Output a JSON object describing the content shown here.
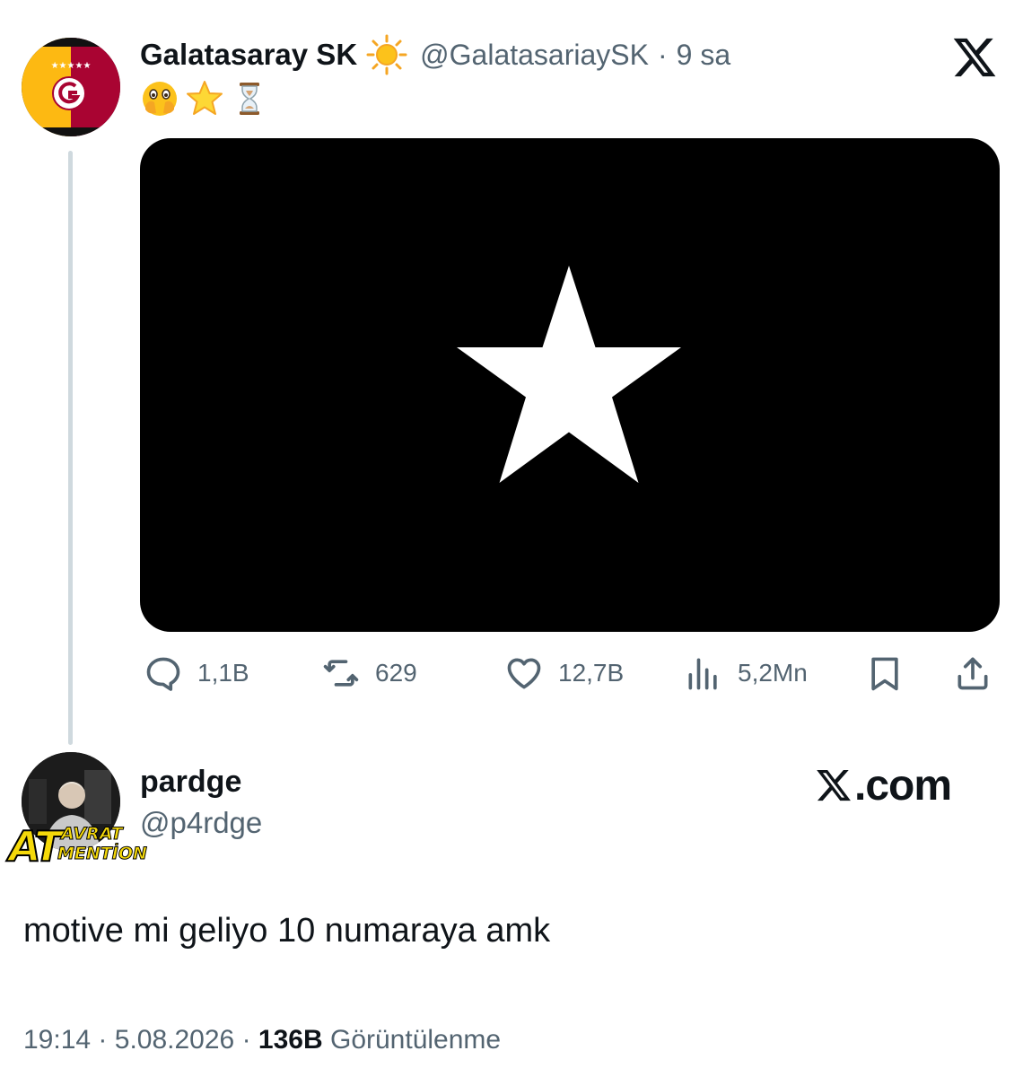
{
  "parent_tweet": {
    "display_name": "Galatasaray SK",
    "handle": "@GalatasariaySK",
    "separator": "·",
    "time_ago": "9 sa",
    "emojis": [
      "face-with-hand-over-mouth-icon",
      "star-icon",
      "hourglass-icon"
    ],
    "media": {
      "background": "#000000",
      "icon": "white-star-icon"
    },
    "actions": {
      "replies": "1,1B",
      "retweets": "629",
      "likes": "12,7B",
      "views": "5,2Mn"
    },
    "brand_colors": {
      "gs_red": "#a90432",
      "gs_yellow": "#fdb912"
    }
  },
  "reply_tweet": {
    "display_name": "pardge",
    "handle": "@p4rdge",
    "badge": {
      "letters": "AT",
      "word1": "AVRAT",
      "word2": "MENTİON"
    },
    "brand_logo_text": ".com",
    "text": "motive mi geliyo 10 numaraya amk",
    "time": "19:14",
    "date": "5.08.2026",
    "separator": "·",
    "views_count": "136B",
    "views_label": "Görüntülenme"
  },
  "colors": {
    "text_primary": "#0f1419",
    "text_secondary": "#536471",
    "thread_line": "#cfd9de"
  }
}
